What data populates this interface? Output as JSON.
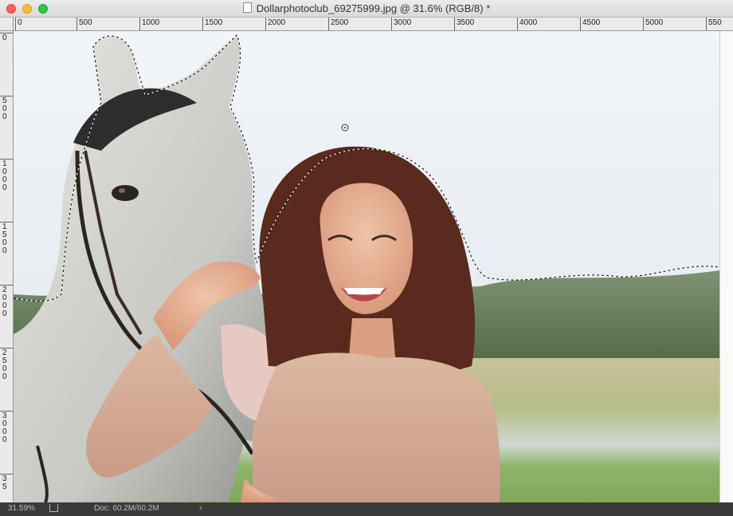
{
  "window": {
    "title": "Dollarphotoclub_69275999.jpg @ 31.6% (RGB/8) *",
    "file_icon": "document-icon"
  },
  "ruler_h": [
    "0",
    "500",
    "1000",
    "1500",
    "2000",
    "2500",
    "3000",
    "3500",
    "4000",
    "4500",
    "5000",
    "550"
  ],
  "ruler_v": [
    "0",
    "500",
    "1000",
    "1500",
    "2000",
    "2500",
    "3000",
    "35"
  ],
  "status": {
    "zoom": "31.59%",
    "doc": "Doc: 60.2M/60.2M",
    "arrow": "›"
  },
  "colors": {
    "sky": "#e8eef3",
    "tree_line": "#607a4e",
    "field": "#8fae60",
    "hair": "#5a2a1e",
    "sweater": "#d9b39a",
    "horse": "#d9d9d6"
  }
}
